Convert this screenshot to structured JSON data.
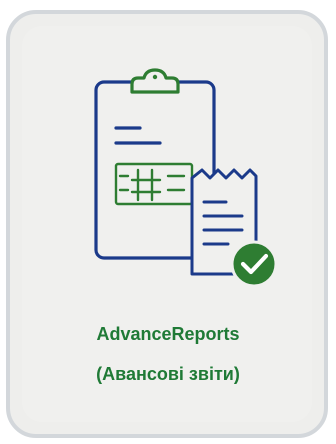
{
  "card": {
    "title_line1": "AdvanceReports",
    "title_line2": "(Авансові звіти)"
  },
  "colors": {
    "outline_blue": "#1b3a8a",
    "accent_green": "#2e7d32",
    "title_green": "#1f7a36",
    "card_background": "#eeeeec",
    "card_border": "#d3d7db"
  },
  "icons": [
    "clipboard-icon",
    "receipt-icon",
    "checkmark-badge-icon",
    "grid-hash-icon"
  ]
}
